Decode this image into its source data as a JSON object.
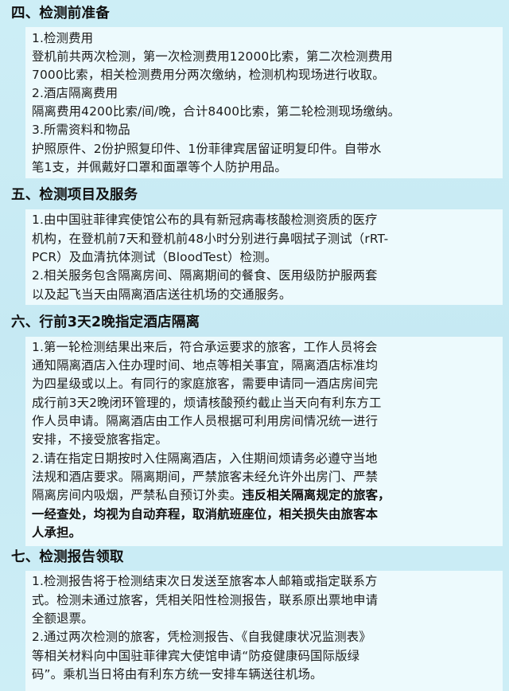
{
  "sections": [
    {
      "heading": "四、检测前准备",
      "lines": [
        "1.检测费用",
        "登机前共两次检测，第一次检测费用12000比索，第二次检测费用",
        "7000比索，相关检测费用分两次缴纳，检测机构现场进行收取。",
        "2.酒店隔离费用",
        "隔离费用4200比索/间/晚，合计8400比索，第二轮检测现场缴纳。",
        "3.所需资料和物品",
        "护照原件、2份护照复印件、1份菲律宾居留证明复印件。自带水",
        "笔1支，并佩戴好口罩和面罩等个人防护用品。"
      ]
    },
    {
      "heading": "五、检测项目及服务",
      "lines": [
        "1.由中国驻菲律宾使馆公布的具有新冠病毒核酸检测资质的医疗",
        "机构，在登机前7天和登机前48小时分别进行鼻咽拭子测试（rRT-",
        "PCR）及血清抗体测试（BloodTest）检测。",
        "2.相关服务包含隔离房间、隔离期间的餐食、医用级防护服两套",
        "以及起飞当天由隔离酒店送往机场的交通服务。"
      ]
    },
    {
      "heading": "六、行前3天2晚指定酒店隔离",
      "lines": [
        "1.第一轮检测结果出来后，符合承运要求的旅客，工作人员将会",
        "通知隔离酒店入住办理时间、地点等相关事宜，隔离酒店标准均",
        "为四星级或以上。有同行的家庭旅客，需要申请同一酒店房间完",
        "成行前3天2晚闭环管理的，烦请核酸预约截止当天向有利东方工",
        "作人员申请。隔离酒店由工作人员根据可利用房间情况统一进行",
        "安排，不接受旅客指定。",
        "2.请在指定日期按时入住隔离酒店，入住期间烦请务必遵守当地",
        "法规和酒店要求。隔离期间，严禁旅客未经允许外出房门、严禁"
      ],
      "mixed_line": {
        "normal": "隔离房间内吸烟，严禁私自预订外卖。",
        "bold": "违反相关隔离规定的旅客，"
      },
      "bold_lines": [
        "一经查处，均视为自动弃程，取消航班座位，相关损失由旅客本",
        "人承担。"
      ]
    },
    {
      "heading": "七、检测报告领取",
      "lines": [
        "1.检测报告将于检测结束次日发送至旅客本人邮箱或指定联系方",
        "式。检测未通过旅客，凭相关阳性检测报告，联系原出票地申请",
        "全额退票。",
        "2.通过两次检测的旅客，凭检测报告、《自我健康状况监测表》",
        "等相关材料向中国驻菲律宾大使馆申请“防疫健康码国际版绿",
        "码”。乘机当日将由有利东方统一安排车辆送往机场。"
      ]
    }
  ]
}
